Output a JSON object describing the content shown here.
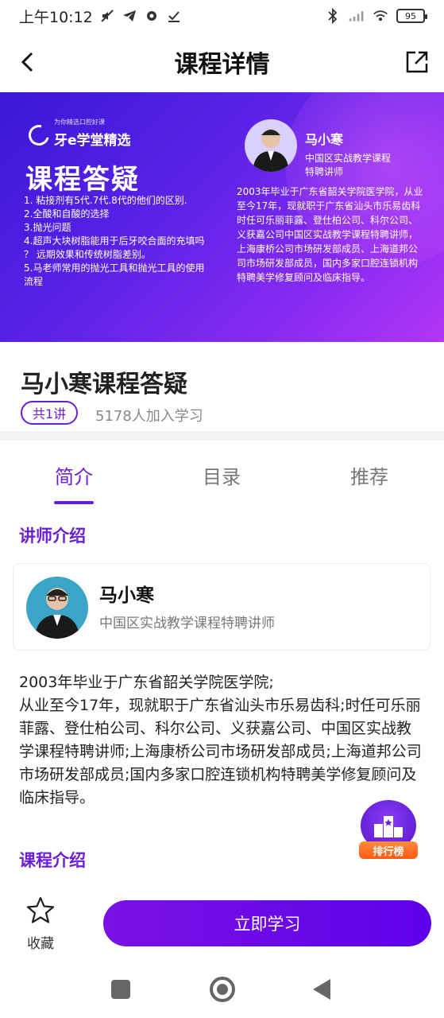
{
  "status_bar": {
    "time": "上午10:12",
    "battery": "95",
    "icons": [
      "mute-icon",
      "telegram-icon",
      "settings-icon",
      "check-icon",
      "bluetooth-icon",
      "signal-icon",
      "wifi-icon",
      "battery-icon"
    ]
  },
  "navbar": {
    "title": "课程详情"
  },
  "banner": {
    "brand_tagline": "为你精选口腔好课",
    "brand_name": "牙e学堂精选",
    "big_title": "课程答疑",
    "points": [
      "1. 粘接剂有5代.7代.8代的他们的区别.",
      "2.全酸和自酸的选择",
      "3.抛光问题",
      "4.超声大块树脂能用于后牙咬合面的充填吗",
      "？ 远期效果和传统树脂差别。",
      "5.马老师常用的抛光工具和抛光工具的使用",
      "流程"
    ],
    "teacher_name": "马小寒",
    "teacher_title_1": "中国区实战教学课程",
    "teacher_title_2": "特聘讲师",
    "teacher_bio": "2003年毕业于广东省韶关学院医学院，从业\n至今17年，现就职于广东省汕头市乐易齿科\n时任可乐丽菲露、登仕柏公司、科尔公司、\n义获嘉公司中国区实战教学课程特聘讲师，\n上海康桥公司市场研发部成员、上海道邦公\n司市场研发部成员，国内多家口腔连锁机构\n特聘美学修复顾问及临床指导。"
  },
  "course": {
    "title": "马小寒课程答疑",
    "lessons_badge": "共1讲",
    "joined": "5178人加入学习"
  },
  "tabs": [
    {
      "label": "简介",
      "active": true
    },
    {
      "label": "目录",
      "active": false
    },
    {
      "label": "推荐",
      "active": false
    }
  ],
  "teacher_section": {
    "label": "讲师介绍",
    "name": "马小寒",
    "role": "中国区实战教学课程特聘讲师",
    "intro": "2003年毕业于广东省韶关学院医学院;\n从业至今17年，现就职于广东省汕头市乐易齿科;时任可乐丽菲露、登仕柏公司、科尔公司、义获嘉公司、中国区实战教学课程特聘讲师;上海康桥公司市场研发部成员;上海道邦公司市场研发部成员;国内多家口腔连锁机构特聘美学修复顾问及临床指导。"
  },
  "course_section": {
    "label": "课程介绍"
  },
  "rank_badge": {
    "label": "排行榜"
  },
  "bottom_bar": {
    "favorite_label": "收藏",
    "study_button": "立即学习"
  },
  "colors": {
    "accent": "#6a1fd6",
    "button": "#6a0ae6",
    "rank_badge": "#ff6a20"
  }
}
